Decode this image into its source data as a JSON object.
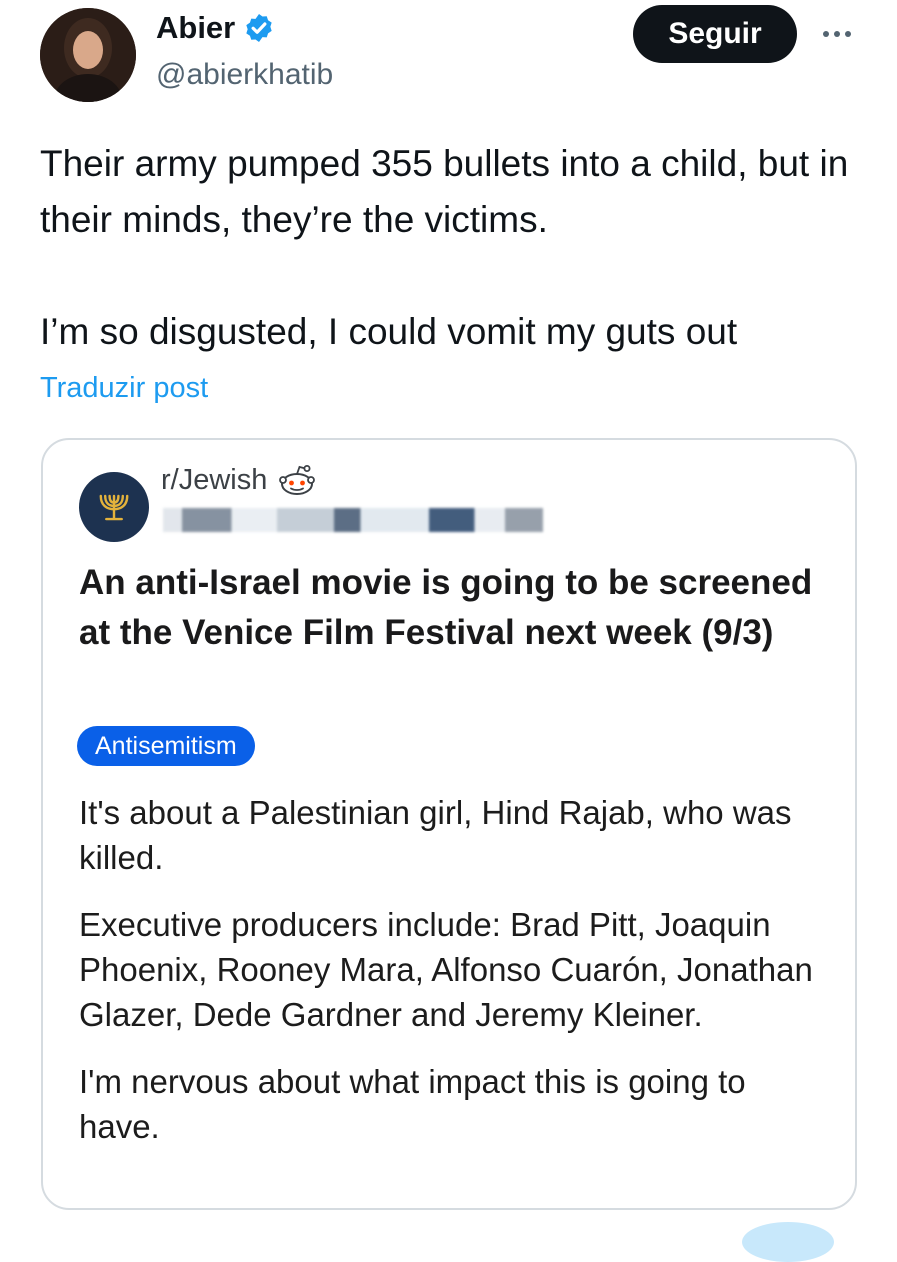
{
  "author": {
    "name": "Abier",
    "handle": "@abierkhatib",
    "verified": true,
    "avatar_icon": "profile-photo"
  },
  "actions": {
    "follow_label": "Seguir",
    "more_icon": "more-horizontal-icon"
  },
  "tweet": {
    "lines": [
      "Their army pumped 355 bullets into a child, but in their minds, they’re the victims.",
      "I’m so disgusted, I could vomit my guts out"
    ],
    "translate_label": "Traduzir post"
  },
  "quoted_post": {
    "subreddit": "r/Jewish",
    "title": "An anti-Israel movie is going to be screened at the Venice Film Festival next week (9/3)",
    "flair": "Antisemitism",
    "paragraphs": [
      "It's about a Palestinian girl, Hind Rajab, who was killed.",
      "Executive producers include: Brad Pitt, Joaquin Phoenix, Rooney Mara, Alfonso Cuarón, Jonathan Glazer, Dede Gardner and Jeremy Kleiner.",
      "I'm nervous about what impact this is going to have."
    ]
  },
  "colors": {
    "link": "#1d9bf0",
    "follow_bg": "#0f1419",
    "flair_bg": "#0a60e8",
    "verified": "#1d9bf0",
    "subreddit_icon_bg": "#1d3250"
  }
}
